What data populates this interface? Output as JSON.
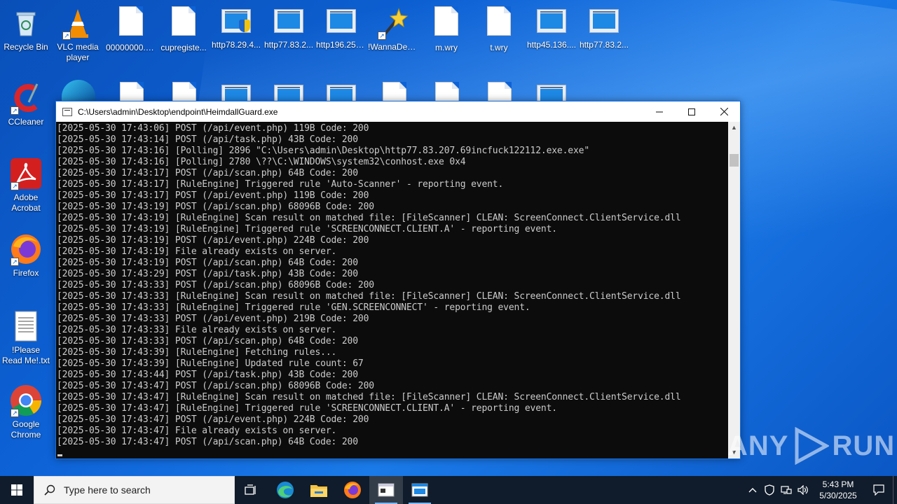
{
  "desktop": {
    "icons_row1": [
      {
        "label": "Recycle Bin",
        "kind": "recycle"
      },
      {
        "label": "VLC media player",
        "kind": "vlc"
      },
      {
        "label": "00000000.res",
        "kind": "doc"
      },
      {
        "label": "cupregiste...",
        "kind": "doc"
      },
      {
        "label": "http78.29.4...",
        "kind": "win-shield"
      },
      {
        "label": "http77.83.2...",
        "kind": "win"
      },
      {
        "label": "http196.251...",
        "kind": "win"
      },
      {
        "label": "!WannaDec...",
        "kind": "wand"
      },
      {
        "label": "m.wry",
        "kind": "doc"
      },
      {
        "label": "t.wry",
        "kind": "doc"
      },
      {
        "label": "http45.136....",
        "kind": "win"
      },
      {
        "label": "http77.83.2...",
        "kind": "win"
      }
    ],
    "icons_col1": [
      {
        "label": "CCleaner",
        "kind": "ccleaner"
      },
      {
        "label": "Adobe Acrobat",
        "kind": "acrobat"
      },
      {
        "label": "Firefox",
        "kind": "firefox"
      },
      {
        "label": "!Please Read Me!.txt",
        "kind": "txt"
      },
      {
        "label": "Google Chrome",
        "kind": "chrome"
      }
    ]
  },
  "console": {
    "title": "C:\\Users\\admin\\Desktop\\endpoint\\HeimdallGuard.exe",
    "lines": [
      "[2025-05-30 17:43:06] POST (/api/event.php) 119B Code: 200",
      "[2025-05-30 17:43:14] POST (/api/task.php) 43B Code: 200",
      "[2025-05-30 17:43:16] [Polling] 2896 \"C:\\Users\\admin\\Desktop\\http77.83.207.69incfuck122112.exe.exe\"",
      "[2025-05-30 17:43:16] [Polling] 2780 \\??\\C:\\WINDOWS\\system32\\conhost.exe 0x4",
      "[2025-05-30 17:43:17] POST (/api/scan.php) 64B Code: 200",
      "[2025-05-30 17:43:17] [RuleEngine] Triggered rule 'Auto-Scanner' - reporting event.",
      "[2025-05-30 17:43:17] POST (/api/event.php) 119B Code: 200",
      "[2025-05-30 17:43:19] POST (/api/scan.php) 68096B Code: 200",
      "[2025-05-30 17:43:19] [RuleEngine] Scan result on matched file: [FileScanner] CLEAN: ScreenConnect.ClientService.dll",
      "[2025-05-30 17:43:19] [RuleEngine] Triggered rule 'SCREENCONNECT.CLIENT.A' - reporting event.",
      "[2025-05-30 17:43:19] POST (/api/event.php) 224B Code: 200",
      "[2025-05-30 17:43:19] File already exists on server.",
      "[2025-05-30 17:43:19] POST (/api/scan.php) 64B Code: 200",
      "[2025-05-30 17:43:29] POST (/api/task.php) 43B Code: 200",
      "[2025-05-30 17:43:33] POST (/api/scan.php) 68096B Code: 200",
      "[2025-05-30 17:43:33] [RuleEngine] Scan result on matched file: [FileScanner] CLEAN: ScreenConnect.ClientService.dll",
      "[2025-05-30 17:43:33] [RuleEngine] Triggered rule 'GEN.SCREENCONNECT' - reporting event.",
      "[2025-05-30 17:43:33] POST (/api/event.php) 219B Code: 200",
      "[2025-05-30 17:43:33] File already exists on server.",
      "[2025-05-30 17:43:33] POST (/api/scan.php) 64B Code: 200",
      "[2025-05-30 17:43:39] [RuleEngine] Fetching rules...",
      "[2025-05-30 17:43:39] [RuleEngine] Updated rule count: 67",
      "[2025-05-30 17:43:44] POST (/api/task.php) 43B Code: 200",
      "[2025-05-30 17:43:47] POST (/api/scan.php) 68096B Code: 200",
      "[2025-05-30 17:43:47] [RuleEngine] Scan result on matched file: [FileScanner] CLEAN: ScreenConnect.ClientService.dll",
      "[2025-05-30 17:43:47] [RuleEngine] Triggered rule 'SCREENCONNECT.CLIENT.A' - reporting event.",
      "[2025-05-30 17:43:47] POST (/api/event.php) 224B Code: 200",
      "[2025-05-30 17:43:47] File already exists on server.",
      "[2025-05-30 17:43:47] POST (/api/scan.php) 64B Code: 200"
    ]
  },
  "watermark": {
    "text_left": "ANY",
    "text_right": "RUN"
  },
  "taskbar": {
    "search_placeholder": "Type here to search",
    "apps": [
      "task-view-icon",
      "edge-icon",
      "file-explorer-icon",
      "firefox-icon",
      "console-icon",
      "console-icon"
    ],
    "clock_time": "5:43 PM",
    "clock_date": "5/30/2025"
  },
  "colors": {
    "desktop_blue": "#0d62d6",
    "console_bg": "#0c0c0c",
    "console_text": "#cccccc",
    "taskbar_bg": "#101c2b"
  }
}
